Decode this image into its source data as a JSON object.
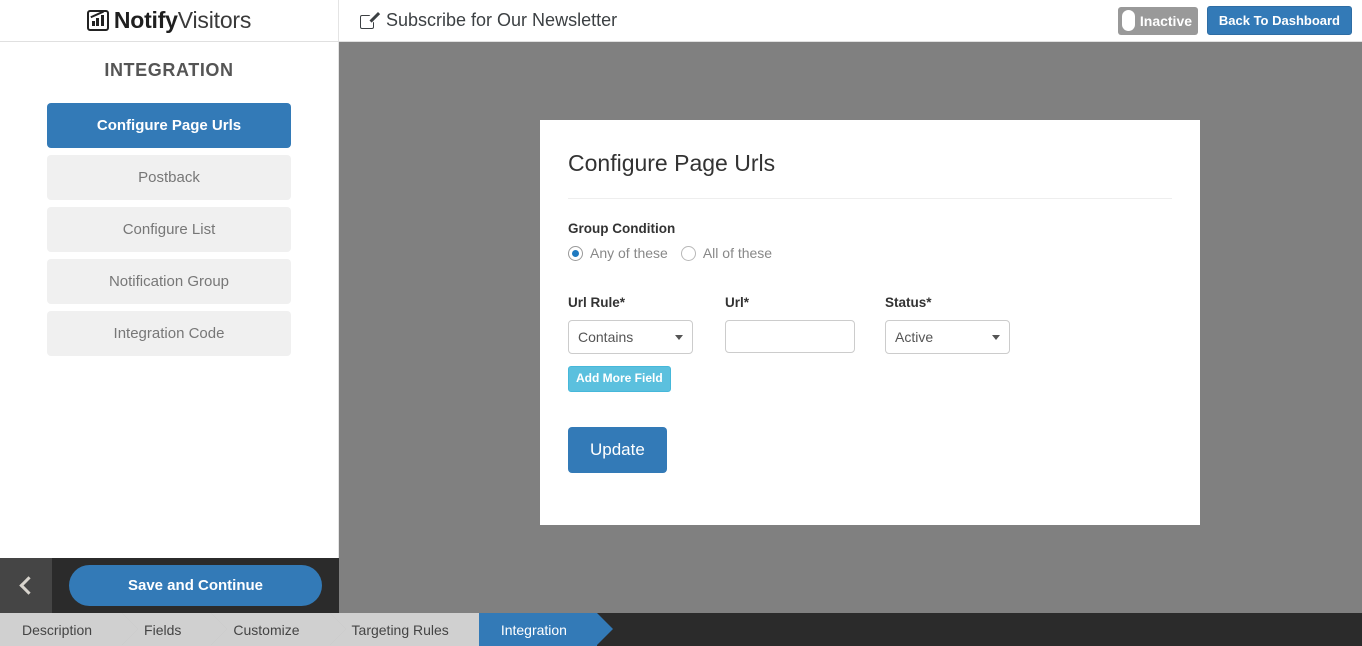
{
  "brand": {
    "name_bold": "Notify",
    "name_light": "Visitors",
    "icon": "chart-bars-icon"
  },
  "header": {
    "page_title": "Subscribe for Our Newsletter",
    "edit_icon": "edit-square-icon",
    "toggle": {
      "label": "Inactive",
      "state": "off",
      "color": "#999999"
    },
    "back_button": {
      "label": "Back To Dashboard",
      "color": "#337ab7"
    }
  },
  "sidebar": {
    "title": "INTEGRATION",
    "items": [
      {
        "label": "Configure Page Urls",
        "active": true
      },
      {
        "label": "Postback",
        "active": false
      },
      {
        "label": "Configure List",
        "active": false
      },
      {
        "label": "Notification Group",
        "active": false
      },
      {
        "label": "Integration Code",
        "active": false
      }
    ],
    "footer": {
      "back_icon": "chevron-left-icon",
      "save_label": "Save and Continue"
    }
  },
  "card": {
    "title": "Configure Page Urls",
    "group_condition": {
      "label": "Group Condition",
      "options": [
        {
          "label": "Any of these",
          "selected": true
        },
        {
          "label": "All of these",
          "selected": false
        }
      ]
    },
    "form": {
      "columns": [
        {
          "label": "Url Rule*",
          "type": "select",
          "value": "Contains"
        },
        {
          "label": "Url*",
          "type": "text",
          "value": "",
          "placeholder": ""
        },
        {
          "label": "Status*",
          "type": "select",
          "value": "Active"
        }
      ],
      "add_more_label": "Add More Field",
      "submit_label": "Update"
    }
  },
  "wizard": {
    "steps": [
      {
        "label": "Description",
        "active": false
      },
      {
        "label": "Fields",
        "active": false
      },
      {
        "label": "Customize",
        "active": false
      },
      {
        "label": "Targeting Rules",
        "active": false
      },
      {
        "label": "Integration",
        "active": true
      }
    ]
  }
}
